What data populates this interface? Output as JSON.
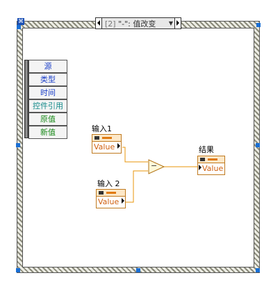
{
  "case_selector": {
    "index": "[2]",
    "text": " \"-\": 值改变"
  },
  "event_data": {
    "items": [
      {
        "label": "源",
        "color": "#1a3ec8"
      },
      {
        "label": "类型",
        "color": "#1a3ec8"
      },
      {
        "label": "时间",
        "color": "#1a3ec8"
      },
      {
        "label": "控件引用",
        "color": "#138a8a"
      },
      {
        "label": "原值",
        "color": "#1a8a1a"
      },
      {
        "label": "新值",
        "color": "#1a8a1a"
      }
    ]
  },
  "controls": {
    "input1": {
      "label": "输入1",
      "value": "Value"
    },
    "input2": {
      "label": "输入 2",
      "value": "Value"
    },
    "result": {
      "label": "结果",
      "value": "Value"
    }
  },
  "subtract_node": {
    "symbol": "−"
  },
  "colors": {
    "wire": "#e8940a",
    "handle": "#1a6fd4"
  }
}
